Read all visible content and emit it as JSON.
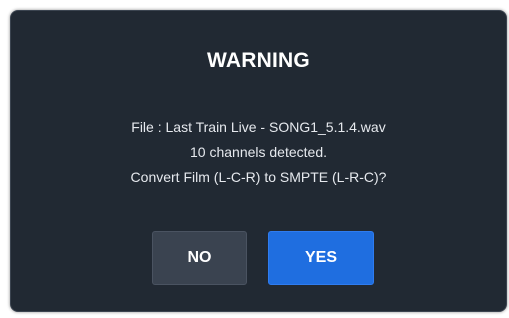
{
  "dialog": {
    "title": "WARNING",
    "message": {
      "line1": "File : Last Train Live - SONG1_5.1.4.wav",
      "line2": "10 channels detected.",
      "line3": "Convert Film (L-C-R) to SMPTE (L-R-C)?"
    },
    "buttons": {
      "no_label": "NO",
      "yes_label": "YES"
    }
  },
  "colors": {
    "dialog_background": "#212933",
    "dialog_border": "#3b4450",
    "no_button": "#3a4350",
    "yes_button": "#1f6ee0",
    "text": "#ffffff"
  }
}
